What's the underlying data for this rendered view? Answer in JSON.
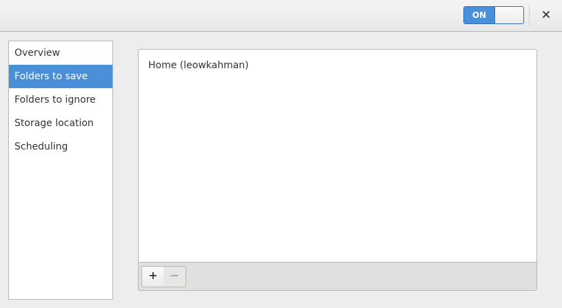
{
  "header": {
    "switch_label": "ON",
    "switch_state": "on",
    "close_icon": "close-icon"
  },
  "sidebar": {
    "selected": 1,
    "items": [
      {
        "label": "Overview"
      },
      {
        "label": "Folders to save"
      },
      {
        "label": "Folders to ignore"
      },
      {
        "label": "Storage location"
      },
      {
        "label": "Scheduling"
      }
    ]
  },
  "main": {
    "folders": [
      {
        "label": "Home (leowkahman)"
      }
    ],
    "toolbar": {
      "add_icon": "plus-icon",
      "remove_icon": "minus-icon",
      "remove_enabled": false
    }
  },
  "colors": {
    "accent": "#4a90d9",
    "accent_border": "#2a6db5",
    "window_bg": "#ededed",
    "text": "#2e3436"
  }
}
